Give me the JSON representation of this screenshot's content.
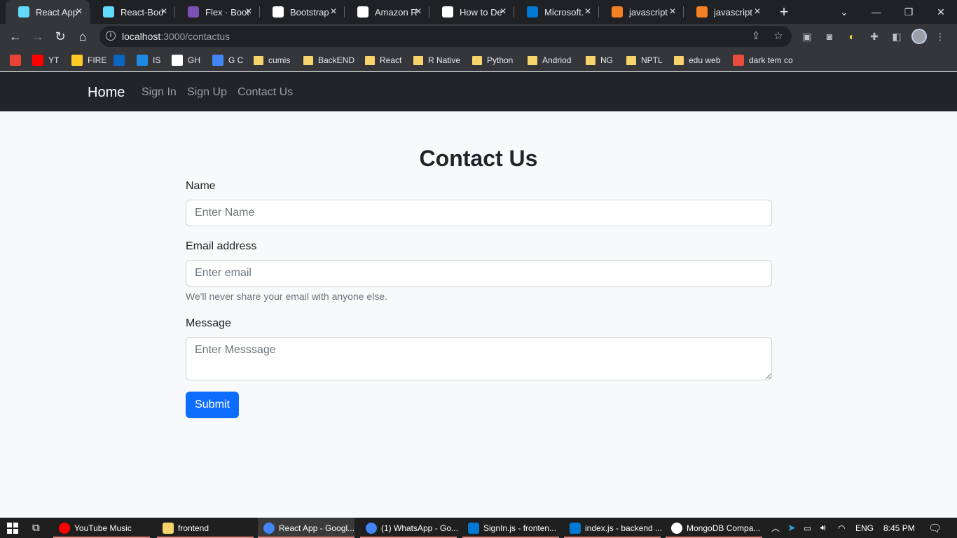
{
  "browser": {
    "tabs": [
      {
        "title": "React App",
        "icon": "react-icon",
        "color": "#61dafb",
        "active": true
      },
      {
        "title": "React-Boot",
        "icon": "react-icon",
        "color": "#61dafb"
      },
      {
        "title": "Flex · Boot",
        "icon": "bootstrap-icon",
        "color": "#7952b3"
      },
      {
        "title": "Bootstrap",
        "icon": "az-icon",
        "color": "#ffffff"
      },
      {
        "title": "Amazon R",
        "icon": "amazon-icon",
        "color": "#ffffff"
      },
      {
        "title": "How to De",
        "icon": "medium-icon",
        "color": "#ffffff"
      },
      {
        "title": "Microsoft.",
        "icon": "azure-icon",
        "color": "#0078d4"
      },
      {
        "title": "javascript",
        "icon": "stackoverflow-icon",
        "color": "#f48024"
      },
      {
        "title": "javascript",
        "icon": "stackoverflow-icon",
        "color": "#f48024"
      }
    ],
    "url_host": "localhost",
    "url_path": ":3000/contactus",
    "bookmarks": [
      {
        "label": "",
        "icon": "gmail-icon",
        "color": "#ea4335"
      },
      {
        "label": "YT",
        "icon": "youtube-icon",
        "color": "#ff0000"
      },
      {
        "label": "FIRE",
        "icon": "firebase-icon",
        "color": "#ffca28"
      },
      {
        "label": "",
        "icon": "linkedin-icon",
        "color": "#0a66c2"
      },
      {
        "label": "IS",
        "icon": "is-icon",
        "color": "#1e88e5"
      },
      {
        "label": "GH",
        "icon": "github-icon",
        "color": "#ffffff"
      },
      {
        "label": "G C",
        "icon": "calendar-icon",
        "color": "#4285f4"
      },
      {
        "label": "cumis",
        "icon": "folder-icon",
        "color": "#f6d36b"
      },
      {
        "label": "BackEND",
        "icon": "folder-icon",
        "color": "#f6d36b"
      },
      {
        "label": "React",
        "icon": "folder-icon",
        "color": "#f6d36b"
      },
      {
        "label": "R Native",
        "icon": "folder-icon",
        "color": "#f6d36b"
      },
      {
        "label": "Python",
        "icon": "folder-icon",
        "color": "#f6d36b"
      },
      {
        "label": "Andriod",
        "icon": "folder-icon",
        "color": "#f6d36b"
      },
      {
        "label": "NG",
        "icon": "folder-icon",
        "color": "#f6d36b"
      },
      {
        "label": "NPTL",
        "icon": "folder-icon",
        "color": "#f6d36b"
      },
      {
        "label": "edu web",
        "icon": "folder-icon",
        "color": "#f6d36b"
      },
      {
        "label": "dark tem co",
        "icon": "bookmark-site-icon",
        "color": "#e74c3c"
      }
    ]
  },
  "navbar": {
    "brand": "Home",
    "links": [
      "Sign In",
      "Sign Up",
      "Contact Us"
    ]
  },
  "form": {
    "title": "Contact Us",
    "name_label": "Name",
    "name_placeholder": "Enter Name",
    "email_label": "Email address",
    "email_placeholder": "Enter email",
    "email_help": "We'll never share your email with anyone else.",
    "message_label": "Message",
    "message_placeholder": "Enter Messsage",
    "submit_label": "Submit"
  },
  "taskbar": {
    "items": [
      {
        "label": "YouTube Music",
        "icon": "youtube-music-icon",
        "color": "#ff0000"
      },
      {
        "label": "frontend",
        "icon": "folder-icon",
        "color": "#f6d36b"
      },
      {
        "label": "React App - Googl...",
        "icon": "chrome-icon",
        "color": "#4285f4",
        "active": true
      },
      {
        "label": "(1) WhatsApp - Go...",
        "icon": "chrome-icon",
        "color": "#4285f4"
      },
      {
        "label": "SignIn.js - fronten...",
        "icon": "vscode-icon",
        "color": "#0078d4"
      },
      {
        "label": "index.js - backend ...",
        "icon": "vscode-icon",
        "color": "#0078d4"
      },
      {
        "label": "MongoDB Compa...",
        "icon": "mongodb-icon",
        "color": "#ffffff"
      }
    ],
    "language": "ENG",
    "time": "8:45 PM"
  }
}
